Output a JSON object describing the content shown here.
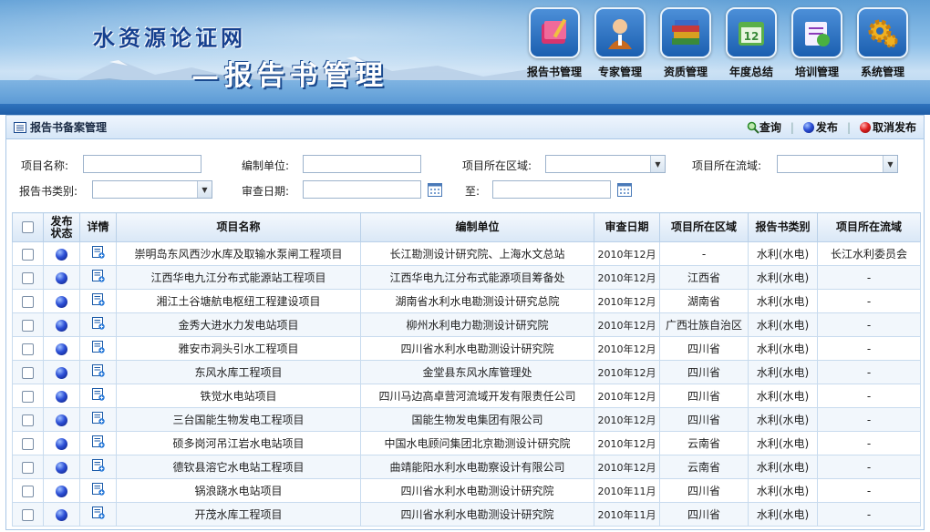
{
  "header": {
    "site_title": "水资源论证网",
    "subtitle": "—报告书管理",
    "nav": [
      {
        "label": "报告书管理",
        "icon": "report-book-icon",
        "color": "#c8326a"
      },
      {
        "label": "专家管理",
        "icon": "expert-person-icon",
        "color": "#c8702a"
      },
      {
        "label": "资质管理",
        "icon": "books-stack-icon",
        "color": "#3a7a3a"
      },
      {
        "label": "年度总结",
        "icon": "calendar-icon",
        "color": "#4aa040"
      },
      {
        "label": "培训管理",
        "icon": "training-pencil-icon",
        "color": "#8a3ab8"
      },
      {
        "label": "系统管理",
        "icon": "gear-icon",
        "color": "#e0a020"
      }
    ]
  },
  "panel": {
    "title": "报告书备案管理",
    "actions": {
      "search": "查询",
      "publish": "发布",
      "unpublish": "取消发布"
    }
  },
  "filters": {
    "project_name": {
      "label": "项目名称:",
      "value": ""
    },
    "compile_unit": {
      "label": "编制单位:",
      "value": ""
    },
    "region": {
      "label": "项目所在区域:",
      "value": ""
    },
    "basin": {
      "label": "项目所在流域:",
      "value": ""
    },
    "report_type": {
      "label": "报告书类别:",
      "value": ""
    },
    "review_date": {
      "label": "审查日期:",
      "from": "",
      "to_label": "至:",
      "to": ""
    }
  },
  "table": {
    "columns": [
      "",
      "发布状态",
      "详情",
      "项目名称",
      "编制单位",
      "审查日期",
      "项目所在区域",
      "报告书类别",
      "项目所在流域"
    ],
    "rows": [
      {
        "name": "崇明岛东风西沙水库及取输水泵闸工程项目",
        "unit": "长江勘测设计研究院、上海水文总站",
        "date": "2010年12月",
        "region": "-",
        "type": "水利(水电)",
        "basin": "长江水利委员会"
      },
      {
        "name": "江西华电九江分布式能源站工程项目",
        "unit": "江西华电九江分布式能源项目筹备处",
        "date": "2010年12月",
        "region": "江西省",
        "type": "水利(水电)",
        "basin": "-"
      },
      {
        "name": "湘江土谷塘航电枢纽工程建设项目",
        "unit": "湖南省水利水电勘测设计研究总院",
        "date": "2010年12月",
        "region": "湖南省",
        "type": "水利(水电)",
        "basin": "-"
      },
      {
        "name": "金秀大进水力发电站项目",
        "unit": "柳州水利电力勘测设计研究院",
        "date": "2010年12月",
        "region": "广西壮族自治区",
        "type": "水利(水电)",
        "basin": "-"
      },
      {
        "name": "雅安市洞头引水工程项目",
        "unit": "四川省水利水电勘测设计研究院",
        "date": "2010年12月",
        "region": "四川省",
        "type": "水利(水电)",
        "basin": "-"
      },
      {
        "name": "东风水库工程项目",
        "unit": "金堂县东风水库管理处",
        "date": "2010年12月",
        "region": "四川省",
        "type": "水利(水电)",
        "basin": "-"
      },
      {
        "name": "铁觉水电站项目",
        "unit": "四川马边高卓营河流域开发有限责任公司",
        "date": "2010年12月",
        "region": "四川省",
        "type": "水利(水电)",
        "basin": "-"
      },
      {
        "name": "三台国能生物发电工程项目",
        "unit": "国能生物发电集团有限公司",
        "date": "2010年12月",
        "region": "四川省",
        "type": "水利(水电)",
        "basin": "-"
      },
      {
        "name": "硕多岗河吊江岩水电站项目",
        "unit": "中国水电顾问集团北京勘测设计研究院",
        "date": "2010年12月",
        "region": "云南省",
        "type": "水利(水电)",
        "basin": "-"
      },
      {
        "name": "德钦县溶它水电站工程项目",
        "unit": "曲靖能阳水利水电勘察设计有限公司",
        "date": "2010年12月",
        "region": "云南省",
        "type": "水利(水电)",
        "basin": "-"
      },
      {
        "name": "锅浪跷水电站项目",
        "unit": "四川省水利水电勘测设计研究院",
        "date": "2010年11月",
        "region": "四川省",
        "type": "水利(水电)",
        "basin": "-"
      },
      {
        "name": "开茂水库工程项目",
        "unit": "四川省水利水电勘测设计研究院",
        "date": "2010年11月",
        "region": "四川省",
        "type": "水利(水电)",
        "basin": "-"
      }
    ]
  }
}
